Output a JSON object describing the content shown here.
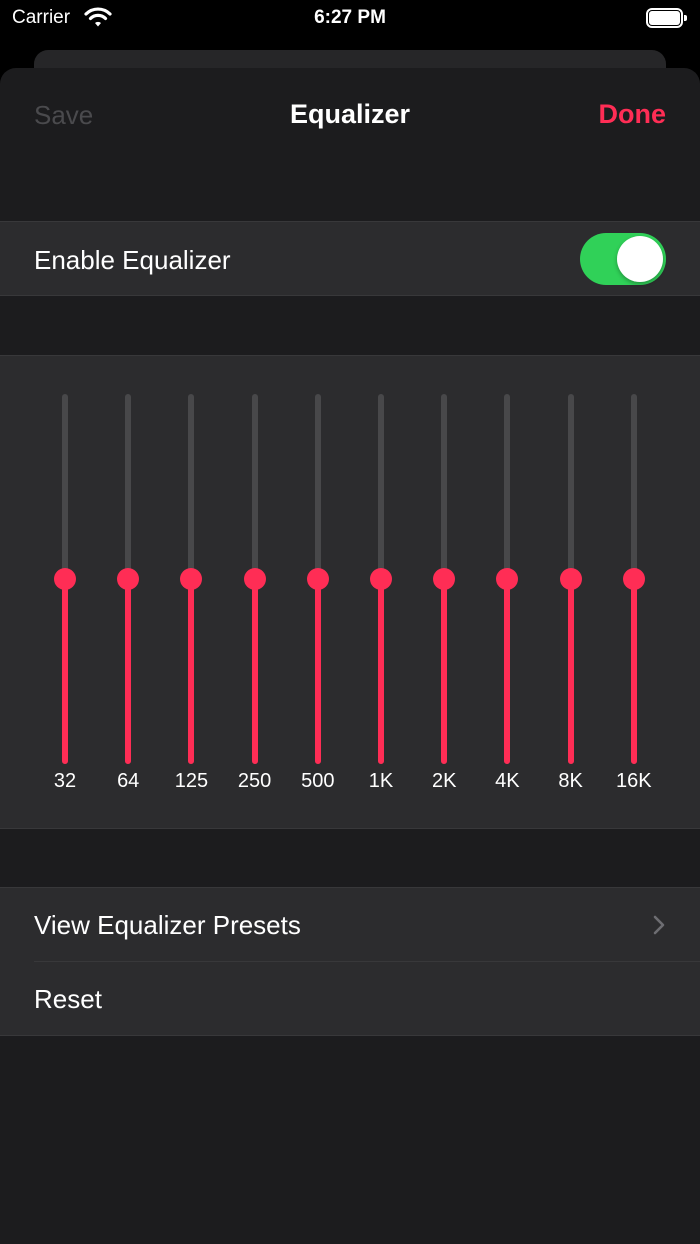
{
  "status_bar": {
    "carrier": "Carrier",
    "time": "6:27 PM"
  },
  "nav": {
    "save_label": "Save",
    "title": "Equalizer",
    "done_label": "Done"
  },
  "enable_row": {
    "label": "Enable Equalizer",
    "enabled": true
  },
  "equalizer": {
    "bands": [
      {
        "label": "32",
        "level": 0.5
      },
      {
        "label": "64",
        "level": 0.5
      },
      {
        "label": "125",
        "level": 0.5
      },
      {
        "label": "250",
        "level": 0.5
      },
      {
        "label": "500",
        "level": 0.5
      },
      {
        "label": "1K",
        "level": 0.5
      },
      {
        "label": "2K",
        "level": 0.5
      },
      {
        "label": "4K",
        "level": 0.5
      },
      {
        "label": "8K",
        "level": 0.5
      },
      {
        "label": "16K",
        "level": 0.5
      }
    ]
  },
  "actions": {
    "presets_label": "View Equalizer Presets",
    "reset_label": "Reset"
  },
  "colors": {
    "accent": "#ff2d55",
    "toggle_on": "#30d158",
    "background": "#1c1c1e",
    "cell": "#2c2c2e",
    "track": "#48484a"
  }
}
